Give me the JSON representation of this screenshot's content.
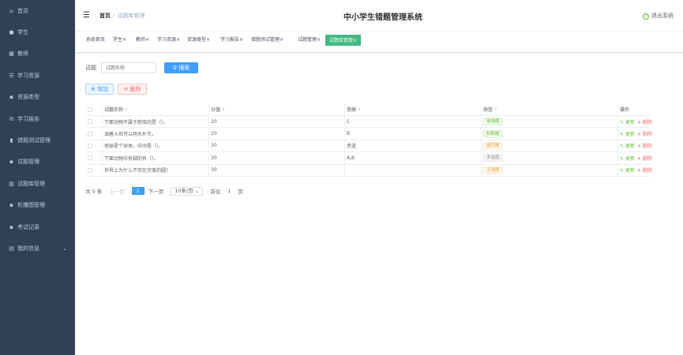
{
  "sidebar": {
    "items": [
      {
        "label": "首页",
        "icon": "home-icon",
        "glyph": "⌂"
      },
      {
        "label": "学生",
        "icon": "user-icon",
        "glyph": "●"
      },
      {
        "label": "教师",
        "icon": "grid-icon",
        "glyph": "▦"
      },
      {
        "label": "学习资源",
        "icon": "list-icon",
        "glyph": "☰"
      },
      {
        "label": "资源类型",
        "icon": "apps-icon",
        "glyph": "▪"
      },
      {
        "label": "学习报告",
        "icon": "mail-icon",
        "glyph": "✉"
      },
      {
        "label": "错题测试管理",
        "icon": "trash-icon",
        "glyph": "▮"
      },
      {
        "label": "试题管理",
        "icon": "apps-icon",
        "glyph": "▪"
      },
      {
        "label": "试题库管理",
        "icon": "chart-icon",
        "glyph": "▥"
      },
      {
        "label": "轮播图管理",
        "icon": "apps-icon",
        "glyph": "▪"
      },
      {
        "label": "考试记录",
        "icon": "apps-icon",
        "glyph": "▪"
      },
      {
        "label": "我的信息",
        "icon": "card-icon",
        "glyph": "▤",
        "chevron": "⌄"
      }
    ]
  },
  "header": {
    "breadcrumb_home": "首页",
    "breadcrumb_sep": "/",
    "breadcrumb_current": "试题库管理",
    "title": "中小学生错题管理系统",
    "logout": "退出系统"
  },
  "tags": [
    {
      "label": "系统首页",
      "closable": false
    },
    {
      "label": "学生",
      "closable": true
    },
    {
      "label": "教师",
      "closable": true
    },
    {
      "label": "学习资源",
      "closable": true
    },
    {
      "label": "资源类型",
      "closable": true
    },
    {
      "label": "学习报告",
      "closable": true
    },
    {
      "label": "错题测试管理",
      "closable": true
    },
    {
      "label": "试题管理",
      "closable": true
    },
    {
      "label": "试题库管理",
      "closable": true,
      "active": true
    }
  ],
  "close_glyph": "×",
  "search": {
    "label": "试题",
    "placeholder": "试题名称",
    "button": "搜索"
  },
  "actions": {
    "add": "增加",
    "delete": "删除"
  },
  "table": {
    "headers": [
      "试题名称",
      "分值",
      "答案",
      "类型",
      "操作"
    ],
    "rows": [
      {
        "name": "下面动物不属于爬虫的是（）。",
        "score": "20",
        "answer": "C",
        "type": "单选题",
        "type_color": "green"
      },
      {
        "name": "油着火后可以用水扑灭。",
        "score": "20",
        "answer": "B",
        "type": "判断题",
        "type_color": "green"
      },
      {
        "name": "地球是个球体，中间是（）。",
        "score": "30",
        "answer": "赤道",
        "type": "填空题",
        "type_color": "orange"
      },
      {
        "name": "下面动物中有脚的有（）。",
        "score": "30",
        "answer": "A,B",
        "type": "多选题",
        "type_color": "gray"
      },
      {
        "name": "世界上为什么不存在完美的圆?",
        "score": "30",
        "answer": "",
        "type": "主观题",
        "type_color": "orange"
      }
    ],
    "row_update": "更新",
    "row_delete": "删除"
  },
  "pagination": {
    "total": "共 5 条",
    "prev": "上一页",
    "current": "1",
    "next": "下一页",
    "page_size": "10条/页",
    "goto_prefix": "前往",
    "goto_value": "1",
    "goto_suffix": "页"
  },
  "colors": {
    "sidebar_bg": "#304156",
    "primary": "#409eff",
    "active_tag": "#42b983",
    "success": "#67c23a",
    "danger": "#f56c6c",
    "warning": "#e6a23c"
  }
}
